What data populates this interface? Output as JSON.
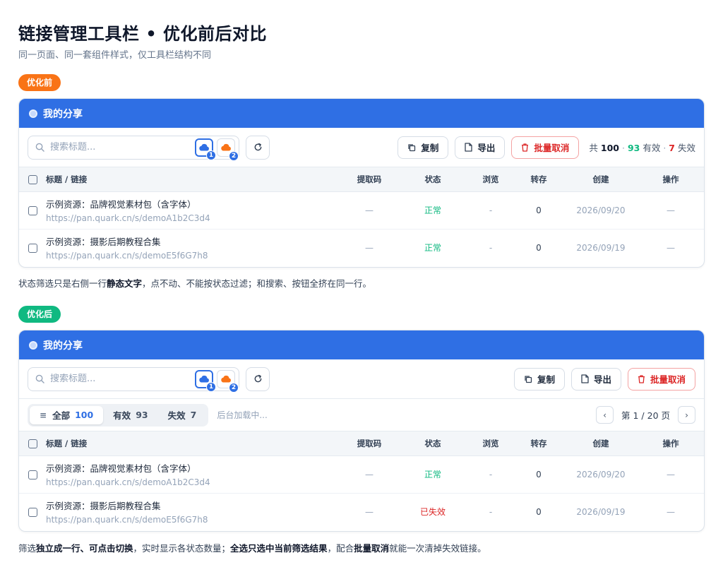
{
  "page": {
    "title": "链接管理工具栏 • 优化前后对比",
    "subtitle": "同一页面、同一套组件样式，仅工具栏结构不同"
  },
  "colors": {
    "primary": "#2f6fe4",
    "before_pill": "#f97316",
    "after_pill": "#10b981",
    "valid": "#10b981",
    "invalid": "#dc2626"
  },
  "before": {
    "pill": "优化前",
    "card_title": "我的分享",
    "search_placeholder": "搜索标题...",
    "cloud1_badge": "1",
    "cloud2_badge": "2",
    "copy_label": "复制",
    "export_label": "导出",
    "batch_cancel_label": "批量取消",
    "count": {
      "prefix": "共",
      "total": "100",
      "dot1": "·",
      "valid": "93",
      "valid_label": "有效",
      "dot2": "·",
      "invalid": "7",
      "invalid_label": "失效"
    },
    "columns": [
      "标题 / 链接",
      "提取码",
      "状态",
      "浏览",
      "转存",
      "创建",
      "操作"
    ],
    "rows": [
      {
        "title": "示例资源：品牌视觉素材包（含字体）",
        "link": "https://pan.quark.cn/s/demoA1b2C3d4",
        "code": "—",
        "status": "正常",
        "views": "-",
        "saves": "0",
        "created": "2026/09/20",
        "action": "—"
      },
      {
        "title": "示例资源：摄影后期教程合集",
        "link": "https://pan.quark.cn/s/demoE5f6G7h8",
        "code": "—",
        "status": "正常",
        "views": "-",
        "saves": "0",
        "created": "2026/09/19",
        "action": "—"
      }
    ],
    "note": {
      "p1": "状态筛选只是右侧一行",
      "b1": "静态文字",
      "p2": "，点不动、不能按状态过滤；和搜索、按钮全挤在同一行。"
    }
  },
  "after": {
    "pill": "优化后",
    "card_title": "我的分享",
    "search_placeholder": "搜索标题...",
    "cloud1_badge": "1",
    "cloud2_badge": "2",
    "copy_label": "复制",
    "export_label": "导出",
    "batch_cancel_label": "批量取消",
    "filter": {
      "all_label": "全部",
      "all_count": "100",
      "valid_label": "有效",
      "valid_count": "93",
      "invalid_label": "失效",
      "invalid_count": "7",
      "loading": "后台加载中..."
    },
    "pager": {
      "prev": "‹",
      "text": "第 1 / 20 页",
      "next": "›"
    },
    "columns": [
      "标题 / 链接",
      "提取码",
      "状态",
      "浏览",
      "转存",
      "创建",
      "操作"
    ],
    "rows": [
      {
        "title": "示例资源：品牌视觉素材包（含字体）",
        "link": "https://pan.quark.cn/s/demoA1b2C3d4",
        "code": "—",
        "status": "正常",
        "views": "-",
        "saves": "0",
        "created": "2026/09/20",
        "action": "—"
      },
      {
        "title": "示例资源：摄影后期教程合集",
        "link": "https://pan.quark.cn/s/demoE5f6G7h8",
        "code": "—",
        "status": "已失效",
        "views": "-",
        "saves": "0",
        "created": "2026/09/19",
        "action": "—"
      }
    ],
    "note": {
      "p1": "筛选",
      "b1": "独立成一行、可点击切换",
      "p2": "，实时显示各状态数量；",
      "b2": "全选只选中当前筛选结果",
      "p3": "，配合",
      "b3": "批量取消",
      "p4": "就能一次清掉失效链接。"
    }
  }
}
